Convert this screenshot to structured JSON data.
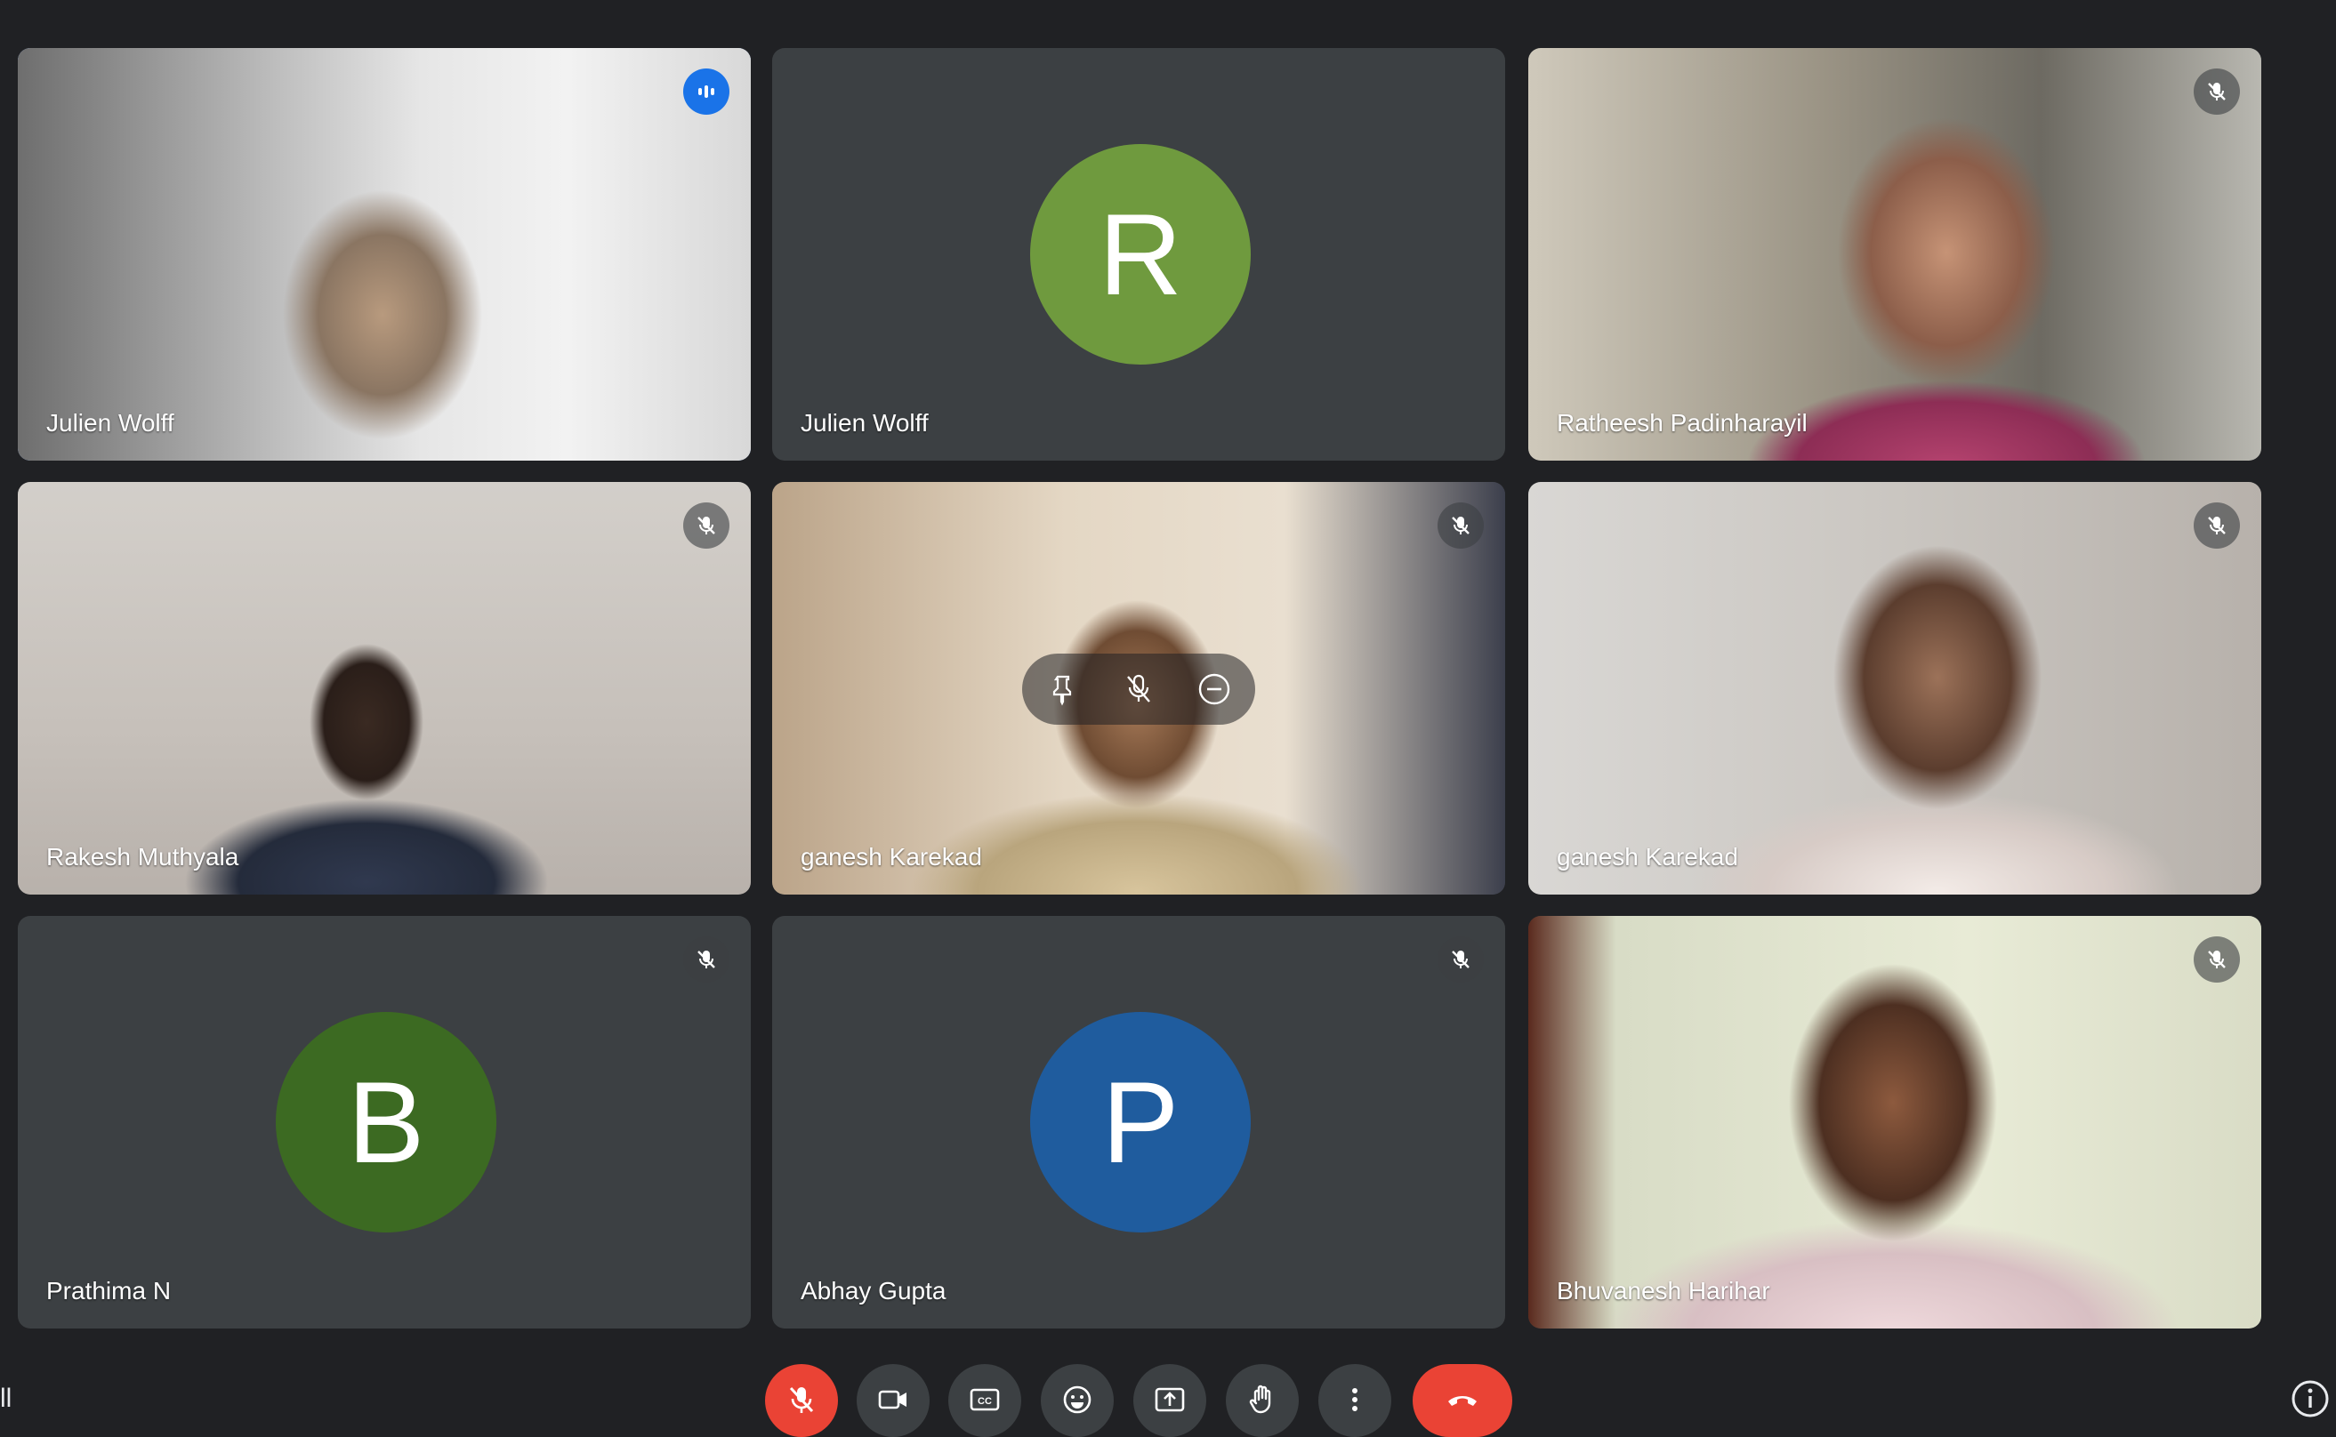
{
  "tiles": [
    {
      "name": "Julien Wolff",
      "speaking": true,
      "status": "speaking-indicator"
    },
    {
      "name": "Julien Wolff",
      "avatar_letter": "R",
      "avatar_color": "#6f9a3e"
    },
    {
      "name": "Ratheesh Padinharayil",
      "status": "muted"
    },
    {
      "name": "Rakesh Muthyala",
      "status": "muted"
    },
    {
      "name": "ganesh Karekad",
      "status": "muted",
      "hover_controls": [
        "pin-icon",
        "mute-icon",
        "remove-icon"
      ]
    },
    {
      "name": "ganesh Karekad",
      "status": "muted"
    },
    {
      "name": "Prathima N",
      "avatar_letter": "B",
      "avatar_color": "#3c6a22",
      "status": "muted"
    },
    {
      "name": "Abhay Gupta",
      "avatar_letter": "P",
      "avatar_color": "#1f5c9e",
      "status": "muted"
    },
    {
      "name": "Bhuvanesh Harihar",
      "status": "muted"
    }
  ],
  "toolbar": {
    "controls": [
      "microphone-off-icon",
      "camera-icon",
      "captions-icon",
      "emoji-icon",
      "present-icon",
      "raise-hand-icon",
      "more-options-icon",
      "leave-call-icon"
    ],
    "leave_color": "#ea4335",
    "mic_off_color": "#ea4335"
  },
  "corner_left_text": "ll",
  "colors": {
    "background": "#202124",
    "tile": "#3c4043",
    "speaking_border": "#8ab4f8",
    "speaking_badge": "#1a73e8"
  }
}
